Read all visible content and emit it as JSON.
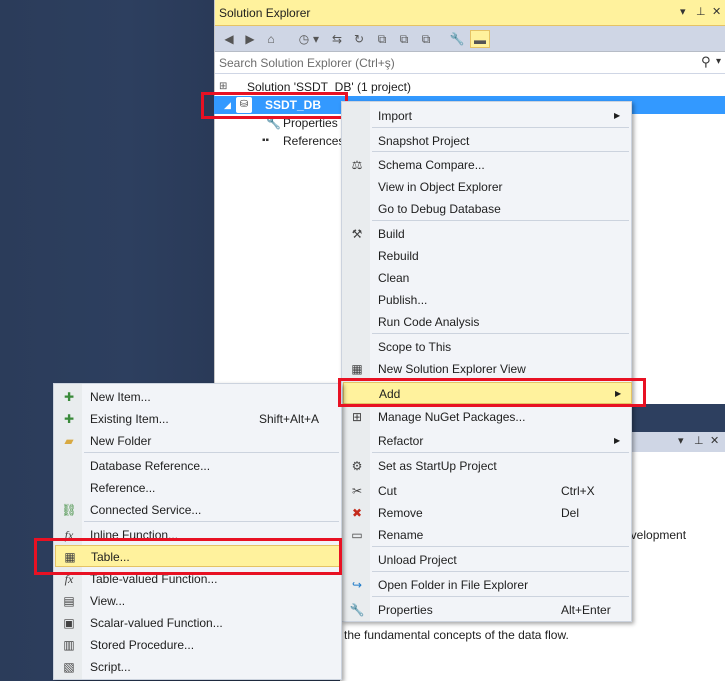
{
  "solution_explorer": {
    "title": "Solution Explorer",
    "title_controls": [
      "▾",
      "⊥",
      "✕"
    ],
    "toolbar": [
      "◀",
      "▶",
      "⌂",
      "◷",
      "▾",
      "⇆",
      "↻",
      "⧉",
      "⧉",
      "⧉",
      "🔧",
      "▬"
    ],
    "search_placeholder": "Search Solution Explorer (Ctrl+ş)",
    "search_icon": "search-icon",
    "tree": {
      "solution": "Solution 'SSDT_DB' (1 project)",
      "project": "SSDT_DB",
      "properties": "Properties",
      "references": "References"
    }
  },
  "project_menu": {
    "items": [
      {
        "label": "Import",
        "submenu": true,
        "icon": ""
      },
      {
        "label": "Snapshot Project",
        "icon": ""
      },
      {
        "label": "Schema Compare...",
        "icon": "schema-compare-icon"
      },
      {
        "label": "View in Object Explorer",
        "icon": ""
      },
      {
        "label": "Go to Debug Database",
        "icon": ""
      },
      {
        "label": "Build",
        "icon": "build-icon"
      },
      {
        "label": "Rebuild",
        "icon": ""
      },
      {
        "label": "Clean",
        "icon": ""
      },
      {
        "label": "Publish...",
        "icon": ""
      },
      {
        "label": "Run Code Analysis",
        "icon": ""
      },
      {
        "label": "Scope to This",
        "icon": ""
      },
      {
        "label": "New Solution Explorer View",
        "icon": "new-view-icon"
      },
      {
        "label": "Add",
        "submenu": true,
        "icon": ""
      },
      {
        "label": "Manage NuGet Packages...",
        "icon": "nuget-icon"
      },
      {
        "label": "Refactor",
        "submenu": true,
        "icon": ""
      },
      {
        "label": "Set as StartUp Project",
        "icon": "gear-icon"
      },
      {
        "label": "Cut",
        "shortcut": "Ctrl+X",
        "icon": "cut-icon"
      },
      {
        "label": "Remove",
        "shortcut": "Del",
        "icon": "remove-icon"
      },
      {
        "label": "Rename",
        "icon": "rename-icon"
      },
      {
        "label": "Unload Project",
        "icon": ""
      },
      {
        "label": "Open Folder in File Explorer",
        "icon": "open-folder-icon"
      },
      {
        "label": "Properties",
        "shortcut": "Alt+Enter",
        "icon": "wrench-icon"
      }
    ]
  },
  "add_menu": {
    "items": [
      {
        "label": "New Item...",
        "icon": "new-item-icon"
      },
      {
        "label": "Existing Item...",
        "shortcut": "Shift+Alt+A",
        "icon": "existing-item-icon"
      },
      {
        "label": "New Folder",
        "icon": "new-folder-icon"
      },
      {
        "label": "Database Reference...",
        "icon": ""
      },
      {
        "label": "Reference...",
        "icon": ""
      },
      {
        "label": "Connected Service...",
        "icon": "connected-service-icon"
      },
      {
        "label": "Inline Function...",
        "icon": "function-icon"
      },
      {
        "label": "Table...",
        "icon": "table-icon"
      },
      {
        "label": "Table-valued Function...",
        "icon": "function-icon"
      },
      {
        "label": "View...",
        "icon": "view-icon"
      },
      {
        "label": "Scalar-valued Function...",
        "icon": "scalar-function-icon"
      },
      {
        "label": "Stored Procedure...",
        "icon": "stored-procedure-icon"
      },
      {
        "label": "Script...",
        "icon": "script-icon"
      }
    ]
  },
  "background_text": {
    "right": "evelopment",
    "bottom": "the fundamental concepts of the data flow."
  },
  "panel2_controls": [
    "▾",
    "⊥",
    "✕"
  ],
  "colors": {
    "selection": "#3399ff",
    "hover": "#fff29d",
    "highlight_box": "#e81123",
    "title_bar": "#fff29d"
  }
}
